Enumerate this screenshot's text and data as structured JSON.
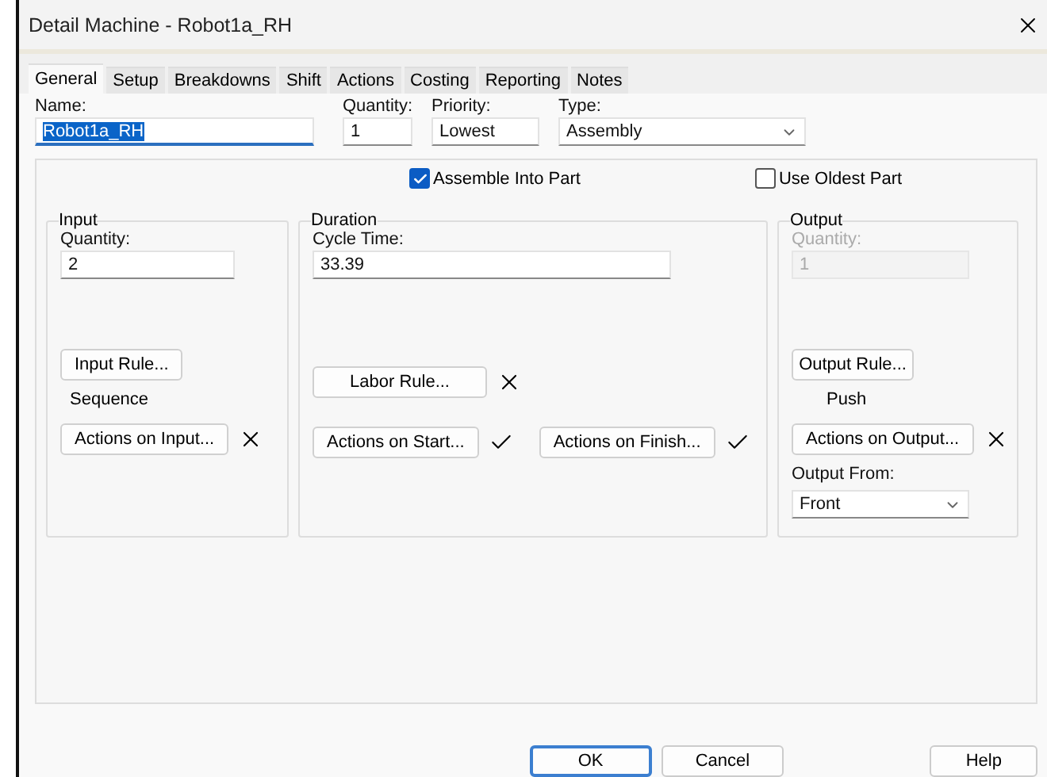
{
  "window": {
    "title": "Detail Machine - Robot1a_RH"
  },
  "tabs": [
    {
      "label": "General",
      "selected": true
    },
    {
      "label": "Setup",
      "selected": false
    },
    {
      "label": "Breakdowns",
      "selected": false
    },
    {
      "label": "Shift",
      "selected": false
    },
    {
      "label": "Actions",
      "selected": false
    },
    {
      "label": "Costing",
      "selected": false
    },
    {
      "label": "Reporting",
      "selected": false
    },
    {
      "label": "Notes",
      "selected": false
    }
  ],
  "header": {
    "name": {
      "label": "Name:",
      "value": "Robot1a_RH",
      "highlighted": true
    },
    "quantity": {
      "label": "Quantity:",
      "value": "1"
    },
    "priority": {
      "label": "Priority:",
      "value": "Lowest"
    },
    "type": {
      "label": "Type:",
      "value": "Assembly"
    }
  },
  "options": [
    {
      "label": "Assemble Into Part",
      "checked": true
    },
    {
      "label": "Use Oldest Part",
      "checked": false
    }
  ],
  "input": {
    "title": "Input",
    "quantity": {
      "label": "Quantity:",
      "value": "2",
      "disabled": false
    },
    "rule_button": "Input Rule...",
    "rule": "Sequence",
    "actions": {
      "label": "Actions on Input...",
      "defined": false
    }
  },
  "duration": {
    "title": "Duration",
    "cycle_time": {
      "label": "Cycle Time:",
      "value": "33.39"
    },
    "labor": {
      "label": "Labor Rule...",
      "defined": false
    },
    "actions": [
      {
        "label": "Actions on Start...",
        "defined": true
      },
      {
        "label": "Actions on Finish...",
        "defined": true
      }
    ]
  },
  "output": {
    "title": "Output",
    "quantity": {
      "label": "Quantity:",
      "value": "1",
      "disabled": true
    },
    "rule_button": "Output Rule...",
    "rule": "Push",
    "actions": {
      "label": "Actions on Output...",
      "defined": false
    },
    "output_from": {
      "label": "Output From:",
      "value": "Front"
    }
  },
  "buttons": [
    {
      "label": "OK",
      "default": true
    },
    {
      "label": "Cancel",
      "default": false
    },
    {
      "label": "Help",
      "default": false
    }
  ]
}
